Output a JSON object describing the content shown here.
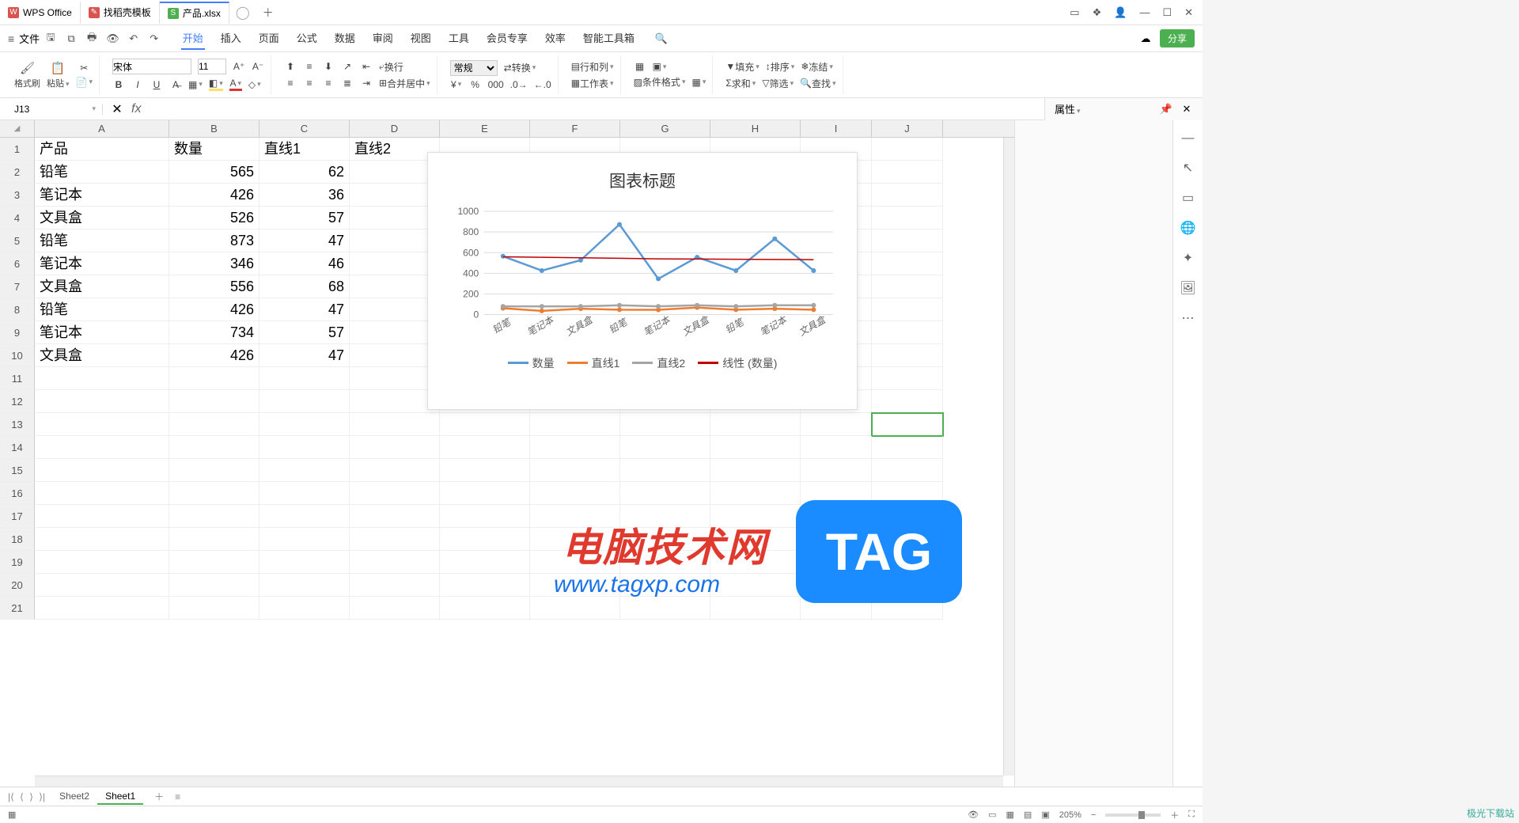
{
  "titlebar": {
    "tabs": [
      {
        "icon": "W",
        "label": "WPS Office",
        "cls": "wps-logo"
      },
      {
        "icon": "✎",
        "label": "找稻壳模板",
        "cls": "doc-logo"
      },
      {
        "icon": "S",
        "label": "产品.xlsx",
        "cls": "xls-logo",
        "active": true
      }
    ]
  },
  "menubar": {
    "file": "文件",
    "tabs": [
      "开始",
      "插入",
      "页面",
      "公式",
      "数据",
      "审阅",
      "视图",
      "工具",
      "会员专享",
      "效率",
      "智能工具箱"
    ],
    "active": 0,
    "share": "分享"
  },
  "ribbon": {
    "brush": "格式刷",
    "paste": "粘贴",
    "font": "宋体",
    "size": "11",
    "numfmt": "常规",
    "convert": "转换",
    "rowcol": "行和列",
    "worksheet": "工作表",
    "condfmt": "条件格式",
    "mergecenter": "合并居中",
    "wraptext": "换行",
    "fill": "填充",
    "sort": "排序",
    "freeze": "冻结",
    "sum": "求和",
    "filter": "筛选",
    "find": "查找"
  },
  "namebox": {
    "ref": "J13",
    "fx": "fx"
  },
  "grid": {
    "cols": [
      "A",
      "B",
      "C",
      "D",
      "E",
      "F",
      "G",
      "H",
      "I",
      "J"
    ],
    "rowCount": 21,
    "headers": {
      "A": "产品",
      "B": "数量",
      "C": "直线1",
      "D": "直线2"
    },
    "data": [
      {
        "A": "铅笔",
        "B": 565,
        "C": 62
      },
      {
        "A": "笔记本",
        "B": 426,
        "C": 36
      },
      {
        "A": "文具盒",
        "B": 526,
        "C": 57
      },
      {
        "A": "铅笔",
        "B": 873,
        "C": 47
      },
      {
        "A": "笔记本",
        "B": 346,
        "C": 46
      },
      {
        "A": "文具盒",
        "B": 556,
        "C": 68
      },
      {
        "A": "铅笔",
        "B": 426,
        "C": 47
      },
      {
        "A": "笔记本",
        "B": 734,
        "C": 57
      },
      {
        "A": "文具盒",
        "B": 426,
        "C": 47
      }
    ],
    "selected": {
      "row": 13,
      "col": "J"
    }
  },
  "chart_data": {
    "type": "line",
    "title": "图表标题",
    "categories": [
      "铅笔",
      "笔记本",
      "文具盒",
      "铅笔",
      "笔记本",
      "文具盒",
      "铅笔",
      "笔记本",
      "文具盒"
    ],
    "series": [
      {
        "name": "数量",
        "color": "#5b9bd5",
        "values": [
          565,
          426,
          526,
          873,
          346,
          556,
          426,
          734,
          426
        ]
      },
      {
        "name": "直线1",
        "color": "#ed7d31",
        "values": [
          62,
          36,
          57,
          47,
          46,
          68,
          47,
          57,
          47
        ]
      },
      {
        "name": "直线2",
        "color": "#a5a5a5",
        "values": [
          80,
          80,
          80,
          90,
          80,
          90,
          80,
          90,
          90
        ]
      },
      {
        "name": "线性 (数量)",
        "color": "#c00000",
        "values": [
          560,
          555,
          550,
          545,
          540,
          538,
          536,
          534,
          532
        ],
        "trend": true
      }
    ],
    "yticks": [
      0,
      200,
      400,
      600,
      800,
      1000
    ],
    "ylim": [
      0,
      1000
    ]
  },
  "prop_pane": {
    "title": "属性"
  },
  "sheets": {
    "tabs": [
      "Sheet2",
      "Sheet1"
    ],
    "active": 1
  },
  "statusbar": {
    "zoom": "205%"
  },
  "watermarks": {
    "a": "电脑技术网",
    "b": "www.tagxp.com",
    "c": "TAG",
    "d": "极光下载站"
  }
}
